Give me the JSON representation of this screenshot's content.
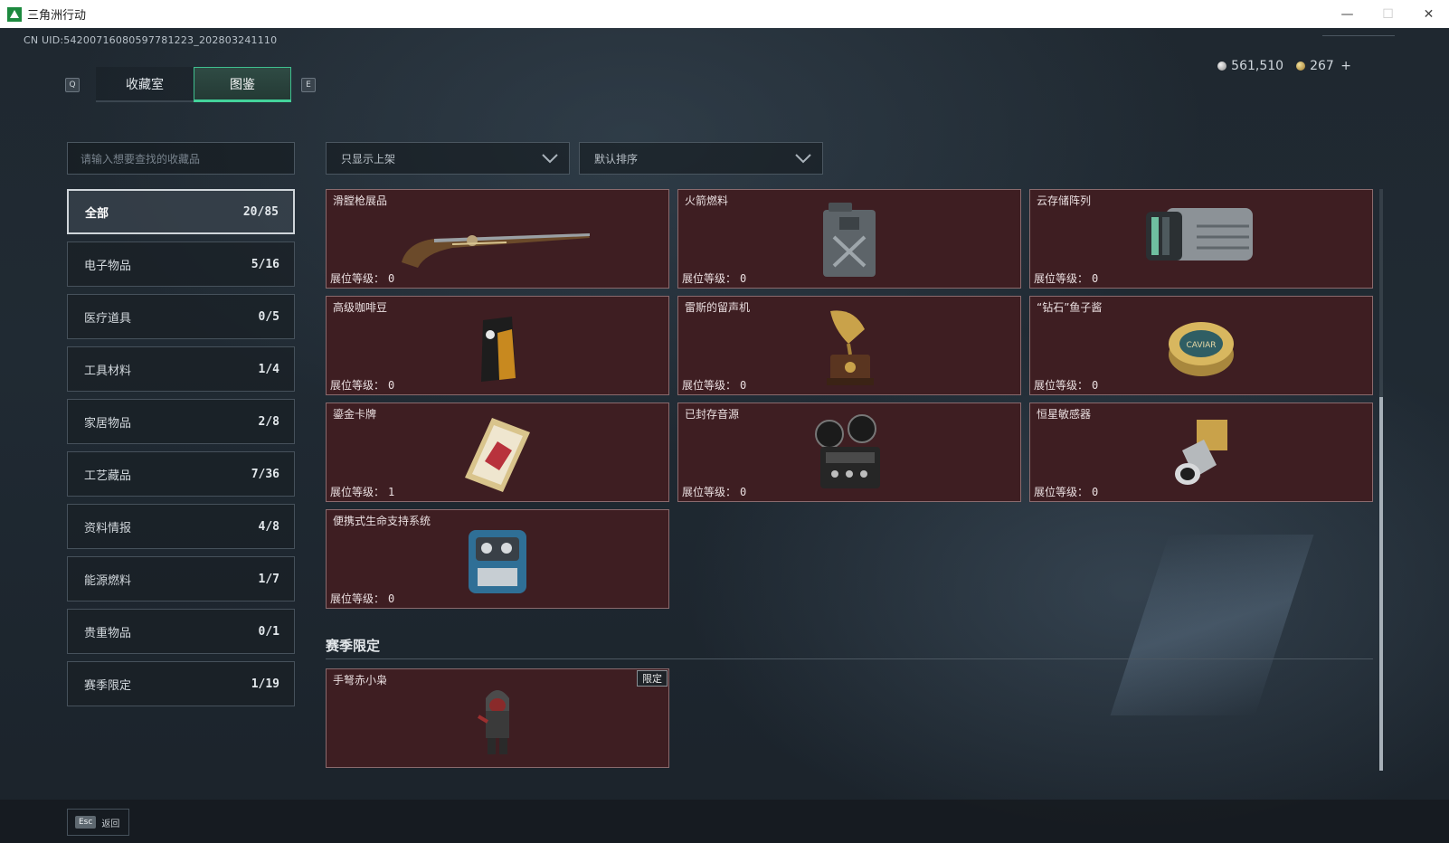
{
  "window": {
    "title": "三角洲行动",
    "controls": {
      "minimize": "—",
      "maximize": "☐",
      "close": "✕"
    }
  },
  "header": {
    "uid": "CN UID:54200716080597781223_202803241110",
    "tabs": [
      {
        "label": "收藏室",
        "active": false
      },
      {
        "label": "图鉴",
        "active": true
      }
    ],
    "tab_keys": {
      "prev": "Q",
      "next": "E"
    },
    "currency": {
      "silver": "561,510",
      "gold": "267",
      "add": "+"
    }
  },
  "sidebar": {
    "search_placeholder": "请输入想要查找的收藏品",
    "categories": [
      {
        "label": "全部",
        "count": "20/85",
        "active": true
      },
      {
        "label": "电子物品",
        "count": "5/16"
      },
      {
        "label": "医疗道具",
        "count": "0/5"
      },
      {
        "label": "工具材料",
        "count": "1/4"
      },
      {
        "label": "家居物品",
        "count": "2/8"
      },
      {
        "label": "工艺藏品",
        "count": "7/36"
      },
      {
        "label": "资料情报",
        "count": "4/8"
      },
      {
        "label": "能源燃料",
        "count": "1/7"
      },
      {
        "label": "贵重物品",
        "count": "0/1"
      },
      {
        "label": "赛季限定",
        "count": "1/19"
      }
    ]
  },
  "filters": {
    "display": "只显示上架",
    "sort": "默认排序"
  },
  "level_label": "展位等级：",
  "items": [
    {
      "name": "滑膛枪展品",
      "level": "0",
      "icon": "musket-icon"
    },
    {
      "name": "火箭燃料",
      "level": "0",
      "icon": "fuel-canister-icon"
    },
    {
      "name": "云存储阵列",
      "level": "0",
      "icon": "storage-array-icon"
    },
    {
      "name": "高级咖啡豆",
      "level": "0",
      "icon": "coffee-bag-icon"
    },
    {
      "name": "雷斯的留声机",
      "level": "0",
      "icon": "gramophone-icon"
    },
    {
      "name": "“钻石”鱼子酱",
      "level": "0",
      "icon": "caviar-tin-icon"
    },
    {
      "name": "鎏金卡牌",
      "level": "1",
      "icon": "gilded-card-icon"
    },
    {
      "name": "已封存音源",
      "level": "0",
      "icon": "tape-recorder-icon"
    },
    {
      "name": "恒星敏感器",
      "level": "0",
      "icon": "star-sensor-icon"
    },
    {
      "name": "便携式生命支持系统",
      "level": "0",
      "icon": "life-support-icon"
    }
  ],
  "season_section": {
    "title": "赛季限定",
    "items": [
      {
        "name": "手弩赤小枭",
        "badge": "限定",
        "icon": "hooded-figure-icon"
      }
    ],
    "caviar_text": "CAVIAR"
  },
  "footer": {
    "esc_key": "Esc",
    "back_label": "返回"
  }
}
